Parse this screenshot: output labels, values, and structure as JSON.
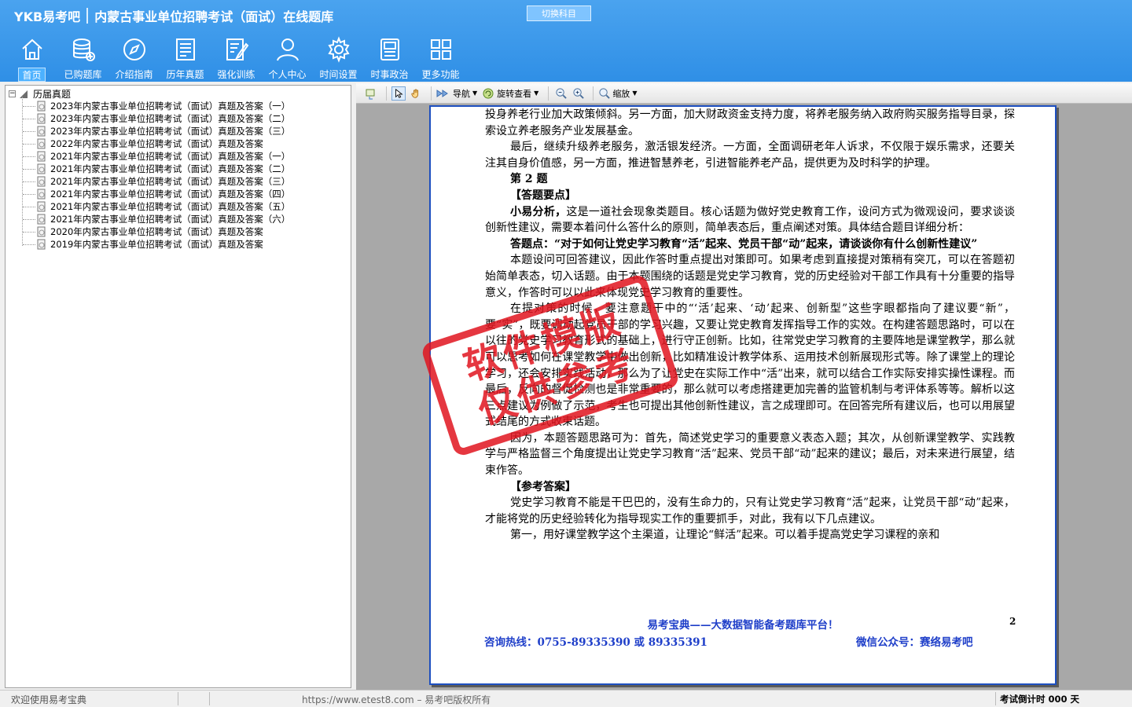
{
  "app": {
    "brand": "YKB易考吧",
    "title": "内蒙古事业单位招聘考试（面试）在线题库",
    "switch_subject": "切换科目"
  },
  "nav": [
    {
      "label": "首页",
      "icon": "home-icon",
      "active": true
    },
    {
      "label": "已购题库",
      "icon": "database-add-icon"
    },
    {
      "label": "介绍指南",
      "icon": "compass-icon"
    },
    {
      "label": "历年真题",
      "icon": "document-list-icon"
    },
    {
      "label": "强化训练",
      "icon": "edit-document-icon"
    },
    {
      "label": "个人中心",
      "icon": "user-icon"
    },
    {
      "label": "时间设置",
      "icon": "gear-icon"
    },
    {
      "label": "时事政治",
      "icon": "newspaper-icon"
    },
    {
      "label": "更多功能",
      "icon": "grid-icon"
    }
  ],
  "tree": {
    "root": "历届真题",
    "items": [
      "2023年内蒙古事业单位招聘考试（面试）真题及答案（一）",
      "2023年内蒙古事业单位招聘考试（面试）真题及答案（二）",
      "2023年内蒙古事业单位招聘考试（面试）真题及答案（三）",
      "2022年内蒙古事业单位招聘考试（面试）真题及答案",
      "2021年内蒙古事业单位招聘考试（面试）真题及答案（一）",
      "2021年内蒙古事业单位招聘考试（面试）真题及答案（二）",
      "2021年内蒙古事业单位招聘考试（面试）真题及答案（三）",
      "2021年内蒙古事业单位招聘考试（面试）真题及答案（四）",
      "2021年内蒙古事业单位招聘考试（面试）真题及答案（五）",
      "2021年内蒙古事业单位招聘考试（面试）真题及答案（六）",
      "2020年内蒙古事业单位招聘考试（面试）真题及答案",
      "2019年内蒙古事业单位招聘考试（面试）真题及答案"
    ]
  },
  "toolbar": {
    "navigate": "导航",
    "rotate": "旋转查看",
    "zoom": "缩放"
  },
  "page": {
    "p1": "投身养老行业加大政策倾斜。另一方面，加大财政资金支持力度，将养老服务纳入政府购买服务指导目录，探索设立养老服务产业发展基金。",
    "p2": "最后，继续升级养老服务，激活银发经济。一方面，全面调研老年人诉求，不仅限于娱乐需求，还要关注其自身价值感，另一方面，推进智慧养老，引进智能养老产品，提供更为及时科学的护理。",
    "q_title": "第 2 题",
    "key_points": "【答题要点】",
    "analysis_label": "小易分析，",
    "analysis": "这是一道社会现象类题目。核心话题为做好党史教育工作，设问方式为微观设问，要求谈谈创新性建议，需要本着问什么答什么的原则，简单表态后，重点阐述对策。具体结合题目详细分析：",
    "answer_point": "答题点：“对于如何让党史学习教育“活”起来、党员干部“动”起来，请谈谈你有什么创新性建议”",
    "p3": "本题设问可回答建议，因此作答时重点提出对策即可。如果考虑到直接提对策稍有突兀，可以在答题初始简单表态，切入话题。由于本题围绕的话题是党史学习教育，党的历史经验对干部工作具有十分重要的指导意义，作答时可以以此来体现党史学习教育的重要性。",
    "p4": "在提对策的时候，要注意题干中的“‘活’起来、‘动’起来、创新型”这些字眼都指向了建议要“新”，要“实”，既要调动起党员干部的学习兴趣，又要让党史教育发挥指导工作的实效。在构建答题思路时，可以在以往的党史学习教育形式的基础上，进行守正创新。比如，往常党史学习教育的主要阵地是课堂教学，那么就可以思考如何在课堂教学中做出创新，比如精准设计教学体系、运用技术创新展现形式等。除了课堂上的理论学习，还会安排实践活动，那么为了让党史在实际工作中“活”出来，就可以结合工作实际安排实操性课程。而最后，反向的督促检测也是非常重要的，那么就可以考虑搭建更加完善的监管机制与考评体系等等。解析以这三点建议为例做了示范，考生也可提出其他创新性建议，言之成理即可。在回答完所有建议后，也可以用展望式结尾的方式收束话题。",
    "p5": "因为，本题答题思路可为：首先，简述党史学习的重要意义表态入题；其次，从创新课堂教学、实践教学与严格监督三个角度提出让党史学习教育“活”起来、党员干部“动”起来的建议；最后，对未来进行展望，结束作答。",
    "ref_answer": "【参考答案】",
    "p6": "党史学习教育不能是干巴巴的，没有生命力的，只有让党史学习教育“活”起来，让党员干部“动”起来，才能将党的历史经验转化为指导现实工作的重要抓手，对此，我有以下几点建议。",
    "p7": "第一，用好课堂教学这个主渠道，让理论“鲜活”起来。可以着手提高党史学习课程的亲和",
    "footer_title": "易考宝典——大数据智能备考题库平台！",
    "page_number": "2",
    "hotline": "咨询热线：0755-89335390 或 89335391",
    "wechat": "微信公众号：赛络易考吧"
  },
  "stamp": {
    "line1": "软件模版",
    "line2": "仅供参考"
  },
  "status": {
    "welcome": "欢迎使用易考宝典",
    "copyright": "https://www.etest8.com – 易考吧版权所有",
    "countdown": "考试倒计时 000 天"
  }
}
